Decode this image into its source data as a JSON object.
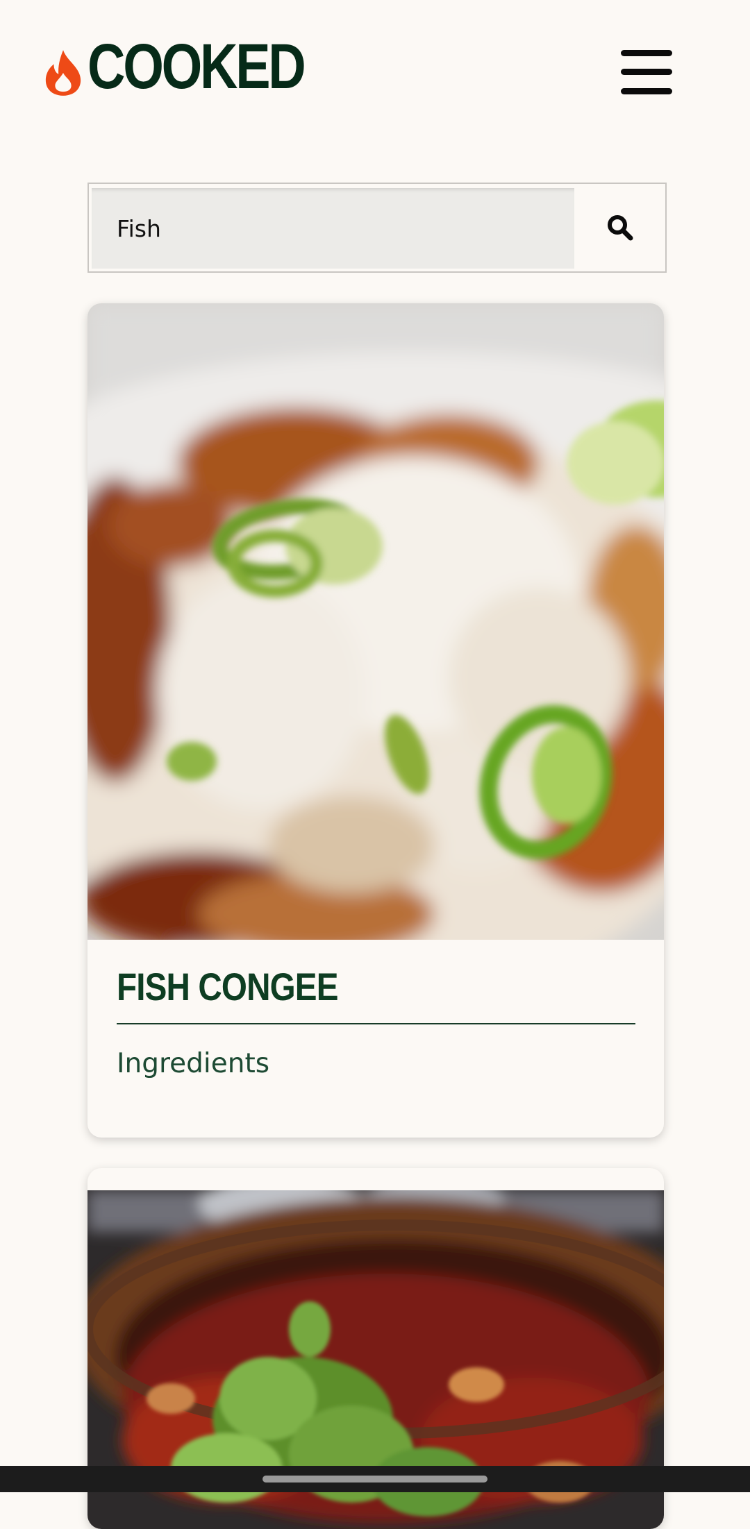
{
  "header": {
    "logo_text": "COOKED",
    "logo_icon": "flame-icon",
    "menu_icon": "hamburger-menu-icon"
  },
  "search": {
    "value": "Fish",
    "icon": "search-icon"
  },
  "results": [
    {
      "title": "FISH CONGEE",
      "link_label": "Ingredients",
      "image": "fish-congee-photo"
    },
    {
      "title": "",
      "image": "fish-stew-photo"
    }
  ],
  "colors": {
    "background": "#fcf9f5",
    "logo_text": "#062a18",
    "flame": "#ee4a16",
    "title": "#0e3d22"
  }
}
